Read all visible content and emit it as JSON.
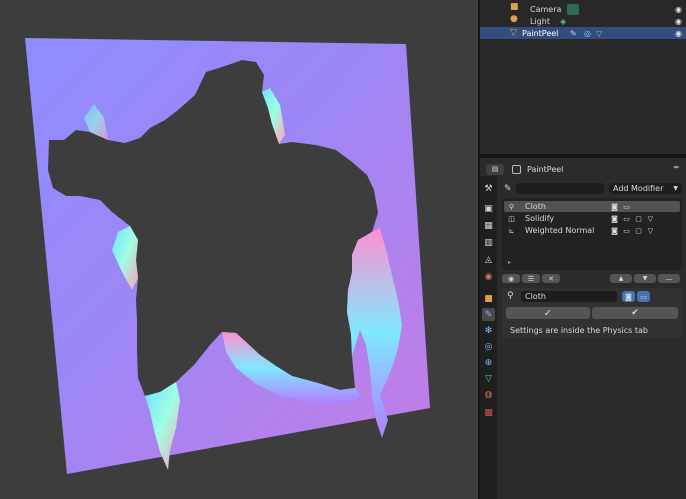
{
  "outliner": {
    "rows": [
      {
        "name": "Camera",
        "icon": "camera-icon"
      },
      {
        "name": "Light",
        "icon": "light-icon"
      },
      {
        "name": "PaintPeel",
        "icon": "mesh-icon"
      }
    ]
  },
  "properties": {
    "object_name": "PaintPeel",
    "search_value": "",
    "add_modifier_label": "Add Modifier",
    "modifiers": [
      {
        "name": "Cloth"
      },
      {
        "name": "Solidify"
      },
      {
        "name": "Weighted Normal"
      }
    ],
    "active_modifier_name": "Cloth",
    "info_text": "Settings are inside the Physics tab"
  },
  "colors": {
    "selection": "#334d80",
    "accent": "#4772b3",
    "panel": "#2b2b2b",
    "viewport": "#3d3d3d"
  }
}
